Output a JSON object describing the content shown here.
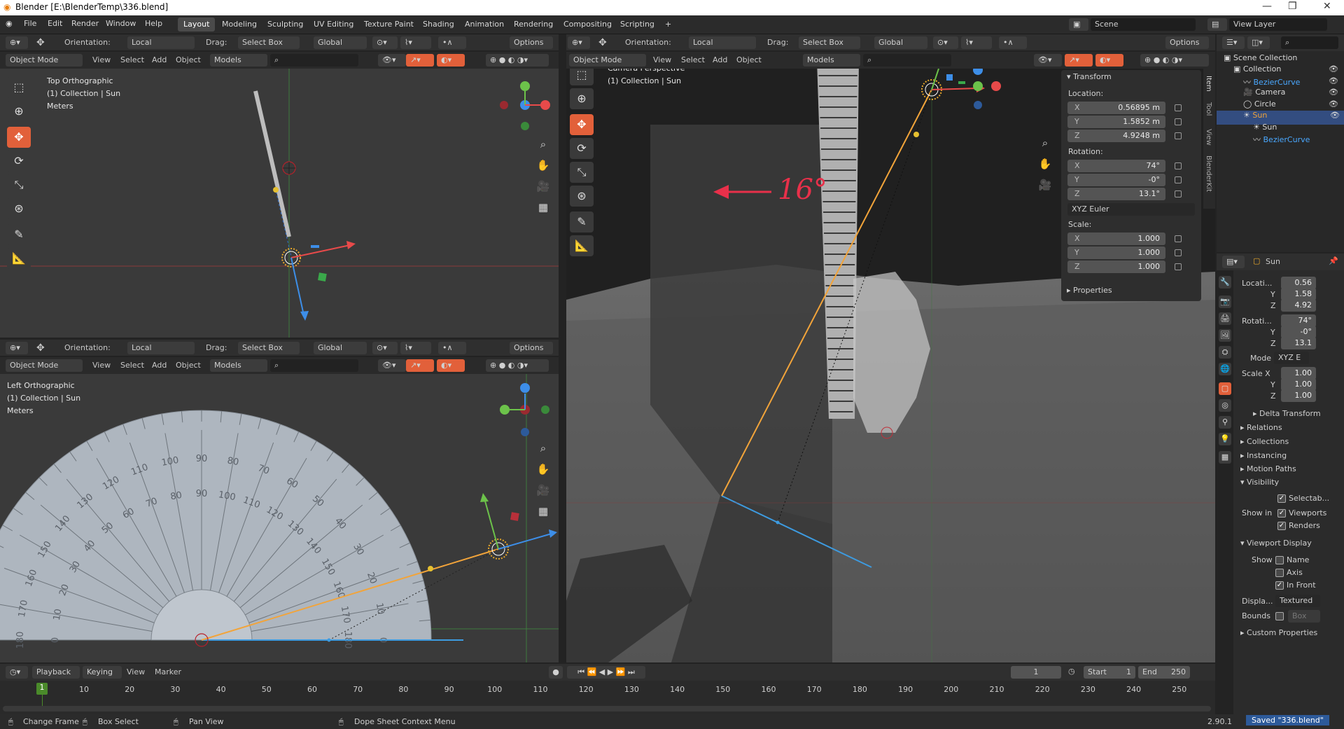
{
  "window": {
    "title": "Blender [E:\\BlenderTemp\\336.blend]",
    "minimize": "—",
    "maximize": "❐",
    "close": "✕"
  },
  "menu": [
    "File",
    "Edit",
    "Render",
    "Window",
    "Help"
  ],
  "workspaces": [
    "Layout",
    "Modeling",
    "Sculpting",
    "UV Editing",
    "Texture Paint",
    "Shading",
    "Animation",
    "Rendering",
    "Compositing",
    "Scripting",
    "+"
  ],
  "scene": {
    "label": "Scene",
    "view_layer": "View Layer"
  },
  "viewport_header": {
    "orientation_label": "Orientation:",
    "orientation_value": "Local",
    "drag_label": "Drag:",
    "drag_value": "Select Box",
    "transform_value": "Global",
    "options": "Options",
    "mode": "Object Mode",
    "view": "View",
    "select": "Select",
    "add": "Add",
    "object": "Object",
    "collection_filter": "Models"
  },
  "viewport_top": {
    "line1": "Top Orthographic",
    "line2": "(1) Collection | Sun",
    "line3": "Meters"
  },
  "viewport_left": {
    "line1": "Left Orthographic",
    "line2": "(1) Collection | Sun",
    "line3": "Meters"
  },
  "viewport_cam": {
    "line1": "Camera Perspective",
    "line2": "(1) Collection | Sun"
  },
  "annotation": "16°",
  "protractor_labels": [
    "0",
    "10",
    "20",
    "30",
    "40",
    "50",
    "60",
    "70",
    "80",
    "90",
    "100",
    "110",
    "120",
    "130",
    "140",
    "150",
    "160",
    "170",
    "180"
  ],
  "transform_panel": {
    "title": "Transform",
    "location_label": "Location:",
    "location": [
      {
        "k": "X",
        "v": "0.56895 m"
      },
      {
        "k": "Y",
        "v": "1.5852 m"
      },
      {
        "k": "Z",
        "v": "4.9248 m"
      }
    ],
    "rotation_label": "Rotation:",
    "rotation": [
      {
        "k": "X",
        "v": "74°"
      },
      {
        "k": "Y",
        "v": "-0°"
      },
      {
        "k": "Z",
        "v": "13.1°"
      }
    ],
    "rotation_mode": "XYZ Euler",
    "scale_label": "Scale:",
    "scale": [
      {
        "k": "X",
        "v": "1.000"
      },
      {
        "k": "Y",
        "v": "1.000"
      },
      {
        "k": "Z",
        "v": "1.000"
      }
    ],
    "properties": "Properties"
  },
  "side_tabs": [
    "Item",
    "Tool",
    "View",
    "BlenderKit"
  ],
  "outliner": {
    "root": "Scene Collection",
    "items": [
      {
        "name": "Collection",
        "level": 1,
        "color": "#d8d8d8"
      },
      {
        "name": "BezierCurve",
        "level": 2,
        "color": "#4aa8ff"
      },
      {
        "name": "Camera",
        "level": 2,
        "color": "#d8d8d8"
      },
      {
        "name": "Circle",
        "level": 2,
        "color": "#d8d8d8"
      },
      {
        "name": "Sun",
        "level": 2,
        "color": "#f0a33a"
      },
      {
        "name": "Sun",
        "level": 3,
        "color": "#d8d8d8"
      },
      {
        "name": "BezierCurve",
        "level": 3,
        "color": "#4aa8ff"
      }
    ]
  },
  "properties_panel": {
    "object_name": "Sun",
    "location_label": "Locati...",
    "location": [
      "0.56",
      "1.58",
      "4.92"
    ],
    "rotation_label": "Rotati...",
    "rotation": [
      "74°",
      "-0°",
      "13.1"
    ],
    "mode_label": "Mode",
    "mode_value": "XYZ E",
    "scale_label": "Scale X",
    "scale": [
      "1.00",
      "1.00",
      "1.00"
    ],
    "axes": [
      "X",
      "Y",
      "Z"
    ],
    "sections": [
      "Delta Transform",
      "Relations",
      "Collections",
      "Instancing",
      "Motion Paths",
      "Visibility"
    ],
    "selectable": "Selectab...",
    "show_in": "Show in",
    "viewports": "Viewports",
    "renders": "Renders",
    "viewport_display": "Viewport Display",
    "show": "Show",
    "name": "Name",
    "axis": "Axis",
    "in_front": "In Front",
    "display_label": "Displa...",
    "display_value": "Textured",
    "bounds_label": "Bounds",
    "bounds_value": "Box",
    "custom_properties": "Custom Properties"
  },
  "timeline": {
    "playback": "Playback",
    "keying": "Keying",
    "view": "View",
    "marker": "Marker",
    "current_frame": "1",
    "start_label": "Start",
    "start": "1",
    "end_label": "End",
    "end": "250",
    "current_marker": "1",
    "ticks": [
      "10",
      "20",
      "30",
      "40",
      "50",
      "60",
      "70",
      "80",
      "90",
      "100",
      "110",
      "120",
      "130",
      "140",
      "150",
      "160",
      "170",
      "180",
      "190",
      "200",
      "210",
      "220",
      "230",
      "240",
      "250"
    ]
  },
  "statusbar": {
    "change_frame": "Change Frame",
    "box_select": "Box Select",
    "pan_view": "Pan View",
    "context_menu": "Dope Sheet Context Menu",
    "version": "2.90.1",
    "saved": "Saved \"336.blend\""
  },
  "colors": {
    "accent": "#e2603a",
    "x_axis": "#e84a4a",
    "y_axis": "#6cc24a",
    "z_axis": "#3d8ee8",
    "sun_line": "#f2a43a",
    "shadow_line": "#3d9be0"
  }
}
